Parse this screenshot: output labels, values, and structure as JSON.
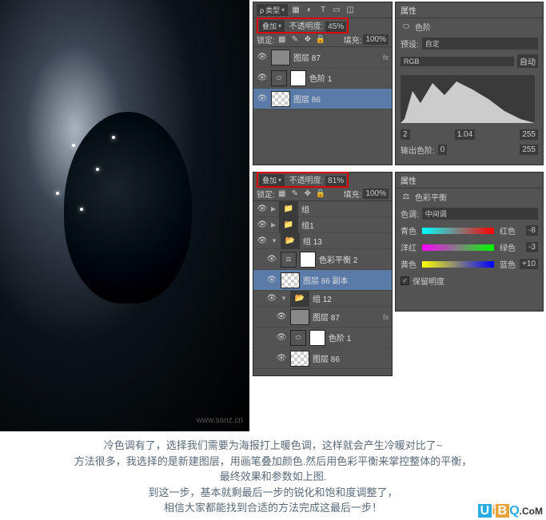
{
  "mainImage": {
    "watermark": "www.sanz.cn"
  },
  "panelTopLayers": {
    "kindLabel": "类型",
    "blendMode": "叠加",
    "opacityLabel": "不透明度:",
    "opacityValue": "45%",
    "lockLabel": "锁定:",
    "fillLabel": "填充:",
    "fillValue": "100%",
    "layers": [
      {
        "name": "图层 87",
        "type": "normal",
        "fx": "fx"
      },
      {
        "name": "色阶 1",
        "type": "adj"
      },
      {
        "name": "图层 86",
        "type": "trans",
        "selected": true
      }
    ]
  },
  "panelTopProps": {
    "tabTitle": "属性",
    "adjName": "色阶",
    "presetLabel": "预设:",
    "presetValue": "自定",
    "channelValue": "RGB",
    "autoBtn": "自动",
    "inVals": {
      "a": "2",
      "b": "1.04",
      "c": "255"
    },
    "outLabel": "输出色阶:",
    "outVals": {
      "a": "0",
      "b": "255"
    }
  },
  "panelBotLayers": {
    "blendMode": "叠加",
    "opacityLabel": "不透明度:",
    "opacityValue": "81%",
    "lockLabel": "锁定:",
    "fillLabel": "填充:",
    "fillValue": "100%",
    "layers": [
      {
        "name": "组",
        "type": "folder"
      },
      {
        "name": "组1",
        "type": "folder"
      },
      {
        "name": "组 13",
        "type": "folder-open"
      },
      {
        "name": "色彩平衡 2",
        "type": "adj",
        "indent": 1
      },
      {
        "name": "图层 86 副本",
        "type": "trans",
        "indent": 1,
        "selected": true
      },
      {
        "name": "组 12",
        "type": "folder-open",
        "indent": 1
      },
      {
        "name": "图层 87",
        "type": "normal",
        "indent": 2,
        "fx": "fx"
      },
      {
        "name": "色阶 1",
        "type": "adj",
        "indent": 2
      },
      {
        "name": "图层 86",
        "type": "trans",
        "indent": 2
      }
    ]
  },
  "panelBotProps": {
    "tabTitle": "属性",
    "adjName": "色彩平衡",
    "toneLabel": "色调:",
    "toneValue": "中间调",
    "sliders": [
      {
        "left": "青色",
        "right": "红色",
        "val": "-8"
      },
      {
        "left": "洋红",
        "right": "绿色",
        "val": "-3"
      },
      {
        "left": "黄色",
        "right": "蓝色",
        "val": "+10"
      }
    ],
    "preserveLabel": "保留明度"
  },
  "bottomText": {
    "l1": "冷色调有了，选择我们需要为海报打上暖色调，这样就会产生冷暖对比了~",
    "l2": "方法很多，我选择的是新建图层，用画笔叠加颜色.然后用色彩平衡来掌控整体的平衡，",
    "l3": "最终效果和参数如上图.",
    "l4": "到这一步，基本就剩最后一步的锐化和饱和度调整了，",
    "l5": "相信大家都能找到合适的方法完成这最后一步！"
  },
  "logo": {
    "u": "U",
    "i": "i",
    "b": "B",
    "q": "Q",
    "com": ".CoM"
  }
}
